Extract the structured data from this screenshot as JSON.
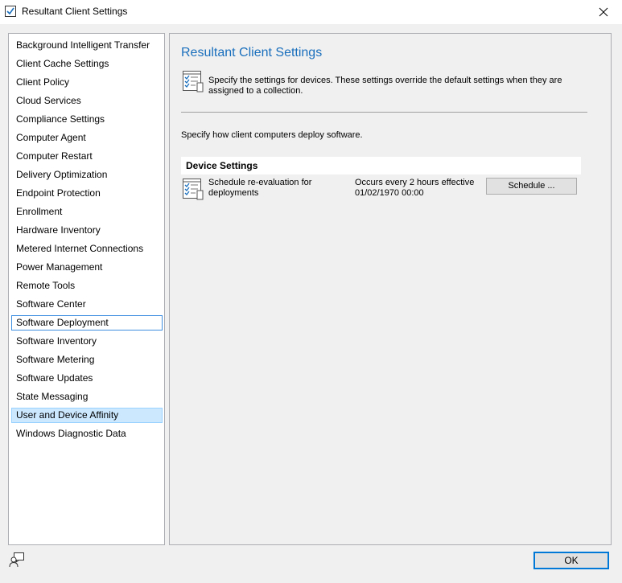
{
  "window": {
    "title": "Resultant Client Settings",
    "icons": {
      "title": "checkbox-icon",
      "close": "close-icon"
    }
  },
  "sidebar": {
    "items": [
      {
        "label": "Background Intelligent Transfer"
      },
      {
        "label": "Client Cache Settings"
      },
      {
        "label": "Client Policy"
      },
      {
        "label": "Cloud Services"
      },
      {
        "label": "Compliance Settings"
      },
      {
        "label": "Computer Agent"
      },
      {
        "label": "Computer Restart"
      },
      {
        "label": "Delivery Optimization"
      },
      {
        "label": "Endpoint Protection"
      },
      {
        "label": "Enrollment"
      },
      {
        "label": "Hardware Inventory"
      },
      {
        "label": "Metered Internet Connections"
      },
      {
        "label": "Power Management"
      },
      {
        "label": "Remote Tools"
      },
      {
        "label": "Software Center"
      },
      {
        "label": "Software Deployment",
        "state": "focused"
      },
      {
        "label": "Software Inventory"
      },
      {
        "label": "Software Metering"
      },
      {
        "label": "Software Updates"
      },
      {
        "label": "State Messaging"
      },
      {
        "label": "User and Device Affinity",
        "state": "selected"
      },
      {
        "label": "Windows Diagnostic Data"
      }
    ]
  },
  "main": {
    "title": "Resultant Client Settings",
    "description": "Specify the settings for devices. These settings override the default settings when they are assigned to a collection.",
    "instruction": "Specify how client computers deploy software.",
    "section_header": "Device Settings",
    "settings": [
      {
        "label": "Schedule re-evaluation for deployments",
        "value": "Occurs every 2 hours effective 01/02/1970 00:00",
        "button_label": "Schedule ..."
      }
    ],
    "icons": {
      "header": "settings-checklist-icon",
      "setting": "settings-checklist-icon"
    }
  },
  "footer": {
    "ok_label": "OK",
    "icons": {
      "feedback": "user-feedback-icon"
    }
  },
  "colors": {
    "title_blue": "#1a6fbd",
    "selected_bg": "#cce8ff",
    "focus_border": "#3d8ee0",
    "default_button_border": "#0078d7"
  }
}
